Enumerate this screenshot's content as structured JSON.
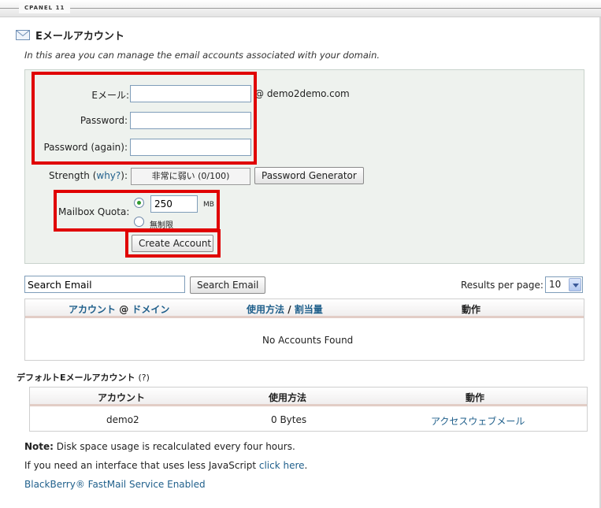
{
  "topbar": {
    "brand": "CPANEL 11"
  },
  "page": {
    "title": "Eメールアカウント",
    "description": "In this area you can manage the email accounts associated with your domain."
  },
  "form": {
    "email_label": "Eメール:",
    "email_value": "",
    "domain": "@ demo2demo.com",
    "password_label": "Password:",
    "password_again_label": "Password (again):",
    "strength_label": "Strength (",
    "strength_why": "why?",
    "strength_close": "):",
    "strength_value": "非常に弱い (0/100)",
    "password_generator": "Password Generator",
    "quota_label": "Mailbox Quota:",
    "quota_value": "250",
    "quota_unit": "MB",
    "unlimited_label": "無制限",
    "create_button": "Create Account"
  },
  "search": {
    "input_value": "Search Email",
    "button": "Search Email",
    "results_label": "Results per page:",
    "results_value": "10"
  },
  "accounts_table": {
    "col_account_a": "アカウント",
    "col_at": "@",
    "col_account_b": "ドメイン",
    "col_usage_a": "使用方法",
    "col_slash": "/",
    "col_usage_b": "割当量",
    "col_action": "動作",
    "empty_text": "No Accounts Found"
  },
  "default_section": {
    "title": "デフォルトEメールアカウント",
    "help": "(?)",
    "col_account": "アカウント",
    "col_usage": "使用方法",
    "col_action": "動作",
    "row": {
      "account": "demo2",
      "usage": "0 Bytes",
      "action": "アクセスウェブメール"
    }
  },
  "footer": {
    "note_bold": "Note:",
    "note_text": " Disk space usage is recalculated every four hours.",
    "js_text": "If you need an interface that uses less JavaScript ",
    "js_link": "click here",
    "js_end": ".",
    "blackberry": "BlackBerry® FastMail Service Enabled"
  },
  "colors": {
    "highlight": "#e00000",
    "link": "#1f5f8b",
    "panel_bg": "#eef2ee"
  }
}
